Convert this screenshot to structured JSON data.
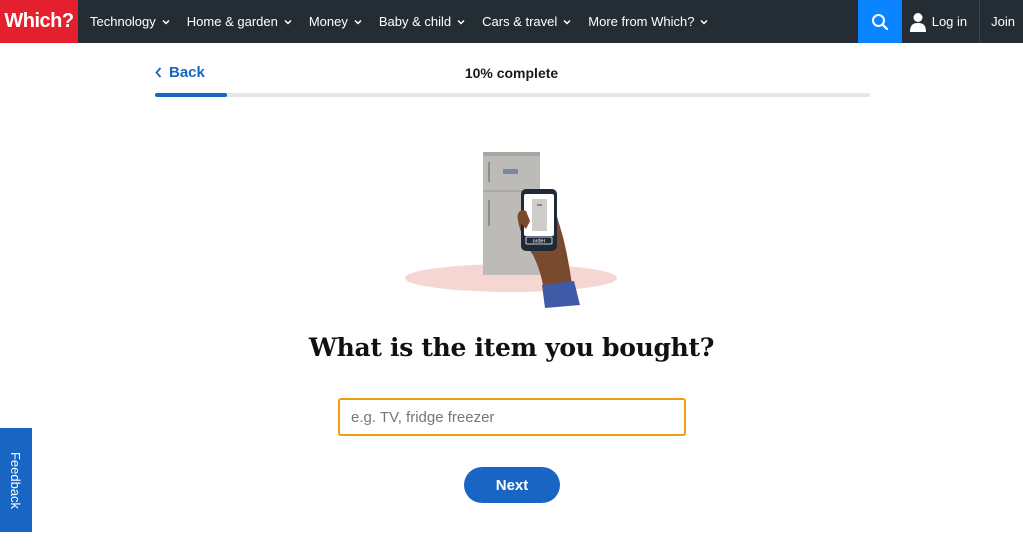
{
  "brand": {
    "logo_text": "Which?",
    "logo_color": "#e4202e",
    "nav_bg": "#232d33",
    "accent": "#1865c4",
    "search_bg": "#0a84ff"
  },
  "nav": {
    "items": [
      {
        "label": "Technology",
        "icon": "chevron-down-icon"
      },
      {
        "label": "Home & garden",
        "icon": "chevron-down-icon"
      },
      {
        "label": "Money",
        "icon": "chevron-down-icon"
      },
      {
        "label": "Baby & child",
        "icon": "chevron-down-icon"
      },
      {
        "label": "Cars & travel",
        "icon": "chevron-down-icon"
      },
      {
        "label": "More from Which?",
        "icon": "chevron-down-icon"
      }
    ],
    "search_icon": "search-icon",
    "login_label": "Log in",
    "login_icon": "user-icon",
    "join_label": "Join"
  },
  "progress": {
    "back_label": "Back",
    "status_text": "10% complete",
    "percent": 10
  },
  "illustration": {
    "icon": "fridge-phone-illustration",
    "phone_button_text": "order"
  },
  "question": {
    "title": "What is the item you bought?",
    "input_placeholder": "e.g. TV, fridge freezer",
    "input_value": "",
    "next_label": "Next"
  },
  "feedback": {
    "label": "Feedback"
  }
}
